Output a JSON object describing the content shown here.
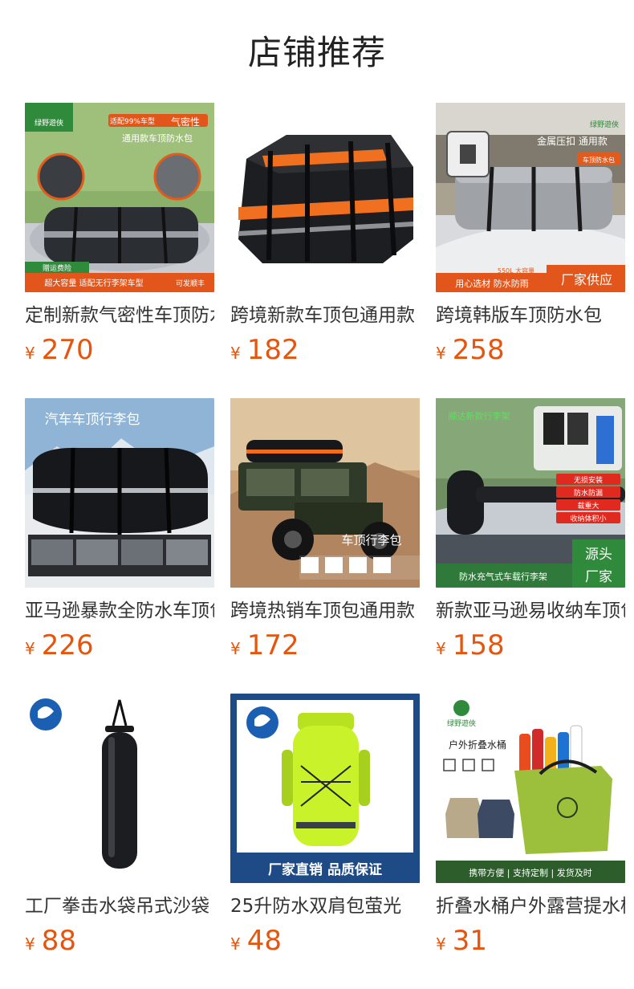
{
  "page": {
    "title": "店铺推荐",
    "currency_symbol": "¥",
    "price_color": "#e4560f"
  },
  "products": [
    {
      "name": "定制新款气密性车顶防水包",
      "price": "270",
      "image_texts": [
        "绿野遊俠",
        "适配99%车型",
        "气密性",
        "通用款车顶防水包",
        "赠运费险",
        "超大容量 适配无行李架车型",
        "可发顺丰"
      ]
    },
    {
      "name": "跨境新款车顶包通用款",
      "price": "182",
      "image_texts": []
    },
    {
      "name": "跨境韩版车顶防水包",
      "price": "258",
      "image_texts": [
        "绿野遊俠",
        "金属压扣 通用款",
        "车顶防水包",
        "550L 大容量",
        "用心选材 防水防雨",
        "厂家供应"
      ]
    },
    {
      "name": "亚马逊暴款全防水车顶包",
      "price": "226",
      "image_texts": [
        "汽车车顶行李包"
      ]
    },
    {
      "name": "跨境热销车顶包通用款",
      "price": "172",
      "image_texts": [
        "车顶行李包"
      ]
    },
    {
      "name": "新款亚马逊易收纳车顶包",
      "price": "158",
      "image_texts": [
        "顺达新款行李架",
        "无损安装",
        "防水防漏",
        "载重大",
        "收纳体积小",
        "防水充气式车载行李架",
        "源头",
        "厂家"
      ]
    },
    {
      "name": "工厂拳击水袋吊式沙袋",
      "price": "88",
      "image_texts": []
    },
    {
      "name": "25升防水双肩包萤光",
      "price": "48",
      "image_texts": [
        "厂家直销 品质保证"
      ]
    },
    {
      "name": "折叠水桶户外露营提水桶",
      "price": "31",
      "image_texts": [
        "绿野遊俠",
        "户外折叠水桶",
        "携带方便 | 支持定制 | 发货及时"
      ]
    }
  ]
}
